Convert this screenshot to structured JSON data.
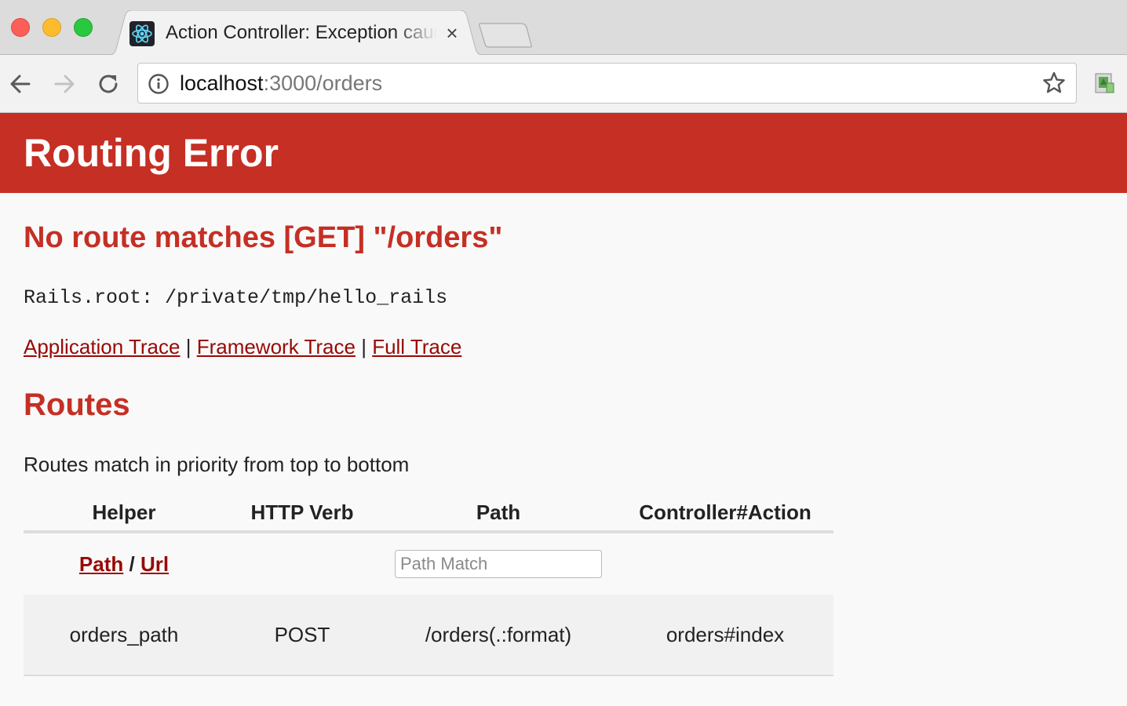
{
  "browser": {
    "tab": {
      "title": "Action Controller: Exception caught",
      "close_glyph": "×",
      "favicon": "react-atom-icon"
    },
    "toolbar": {
      "back_icon": "arrow-left-icon",
      "forward_icon": "arrow-right-icon",
      "reload_icon": "reload-icon"
    },
    "address_bar": {
      "host": "localhost",
      "path": ":3000/orders",
      "info_icon": "info-icon",
      "bookmark_icon": "star-icon"
    },
    "extension_icon": "extension-icon"
  },
  "page": {
    "header_title": "Routing Error",
    "exception_message": "No route matches [GET] \"/orders\"",
    "rails_root": "Rails.root: /private/tmp/hello_rails",
    "trace_links": {
      "application": "Application Trace",
      "framework": "Framework Trace",
      "full": "Full Trace",
      "separator": "|"
    },
    "routes": {
      "heading": "Routes",
      "description": "Routes match in priority from top to bottom",
      "columns": [
        "Helper",
        "HTTP Verb",
        "Path",
        "Controller#Action"
      ],
      "helper_toggle": {
        "path": "Path",
        "separator": "/",
        "url": "Url"
      },
      "search_placeholder": "Path Match",
      "rows": [
        {
          "helper": "orders_path",
          "verb": "POST",
          "path": "/orders(.:format)",
          "action": "orders#index"
        }
      ]
    }
  },
  "colors": {
    "header_red": "#c52f24",
    "link_red": "#980905",
    "page_bg": "#f9f9f9"
  }
}
